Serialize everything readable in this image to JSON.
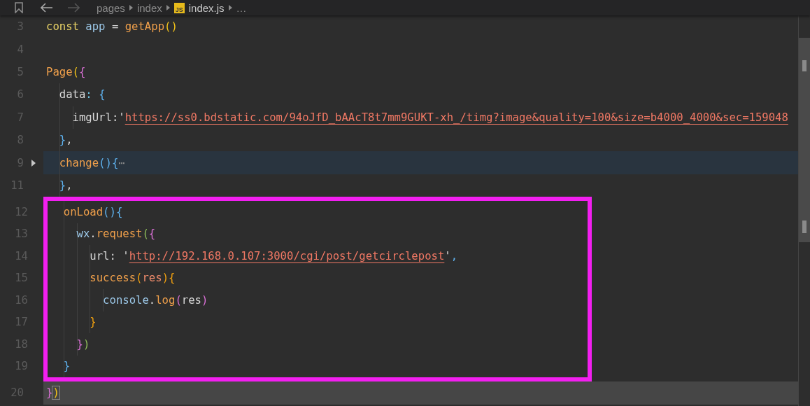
{
  "toolbar": {
    "forward_disabled": true,
    "breadcrumb": [
      {
        "label": "pages",
        "kind": "folder"
      },
      {
        "label": "index",
        "kind": "folder"
      },
      {
        "label": "index.js",
        "kind": "file",
        "badge": "JS"
      },
      {
        "label": "…",
        "kind": "more"
      }
    ]
  },
  "lines_above": [
    {
      "number": "3",
      "tokens": [
        {
          "text": "const ",
          "kind": "keyword"
        },
        {
          "text": "app",
          "kind": "variable"
        },
        {
          "text": " = ",
          "kind": "plain"
        },
        {
          "text": "getApp",
          "kind": "function"
        },
        {
          "text": "()",
          "kind": "bracket1"
        }
      ]
    },
    {
      "number": "4"
    },
    {
      "number": "5",
      "tokens": [
        {
          "text": "Page",
          "kind": "function"
        },
        {
          "text": "(",
          "kind": "bracket1"
        },
        {
          "text": "{",
          "kind": "bracket2"
        }
      ]
    },
    {
      "number": "6",
      "tokens": [
        {
          "text": "  data",
          "kind": "plain"
        },
        {
          "text": ": ",
          "kind": "punct"
        },
        {
          "text": "{",
          "kind": "bracket3"
        }
      ]
    },
    {
      "number": "7",
      "tokens": [
        {
          "text": "    imgUrl",
          "kind": "plain"
        },
        {
          "text": ":'",
          "kind": "plain"
        },
        {
          "text": "https://ss0.bdstatic.com/94oJfD_bAAcT8t7mm9GUKT-xh_/timg?image&quality=100&size=b4000_4000&sec=159048",
          "kind": "link"
        }
      ]
    },
    {
      "number": "8",
      "tokens": [
        {
          "text": "  }",
          "kind": "bracket3"
        },
        {
          "text": ",",
          "kind": "plain"
        }
      ]
    },
    {
      "number": "9",
      "folded": true,
      "tokens": [
        {
          "text": "  change",
          "kind": "function"
        },
        {
          "text": "(){",
          "kind": "bracket3"
        },
        {
          "text": "⋯",
          "kind": "fold"
        }
      ]
    },
    {
      "number": "11",
      "tokens": [
        {
          "text": "  }",
          "kind": "bracket3"
        },
        {
          "text": ",",
          "kind": "plain"
        }
      ]
    }
  ],
  "framed_lines": [
    {
      "number": "12",
      "tokens": [
        {
          "text": "  onLoad",
          "kind": "function"
        },
        {
          "text": "(){",
          "kind": "bracket3"
        }
      ]
    },
    {
      "number": "13",
      "tokens": [
        {
          "text": "    wx",
          "kind": "variable"
        },
        {
          "text": ".",
          "kind": "plain"
        },
        {
          "text": "request",
          "kind": "function"
        },
        {
          "text": "(",
          "kind": "bracket4"
        },
        {
          "text": "{",
          "kind": "bracket2"
        }
      ]
    },
    {
      "number": "14",
      "tokens": [
        {
          "text": "      url",
          "kind": "plain"
        },
        {
          "text": ": '",
          "kind": "plain"
        },
        {
          "text": "http://192.168.0.107:3000/cgi/post/getcirclepost",
          "kind": "link"
        },
        {
          "text": "'",
          "kind": "plain"
        },
        {
          "text": ",",
          "kind": "bracket3"
        }
      ]
    },
    {
      "number": "15",
      "tokens": [
        {
          "text": "      success",
          "kind": "function"
        },
        {
          "text": "(",
          "kind": "bracket5"
        },
        {
          "text": "res",
          "kind": "param"
        },
        {
          "text": "){",
          "kind": "bracket5"
        }
      ]
    },
    {
      "number": "16",
      "tokens": [
        {
          "text": "        console",
          "kind": "variable"
        },
        {
          "text": ".",
          "kind": "plain"
        },
        {
          "text": "log",
          "kind": "function"
        },
        {
          "text": "(",
          "kind": "bracket2"
        },
        {
          "text": "res",
          "kind": "plain"
        },
        {
          "text": ")",
          "kind": "bracket2"
        }
      ]
    },
    {
      "number": "17",
      "tokens": [
        {
          "text": "      }",
          "kind": "bracket5"
        }
      ]
    },
    {
      "number": "18",
      "tokens": [
        {
          "text": "    }",
          "kind": "bracket2"
        },
        {
          "text": ")",
          "kind": "bracket4"
        }
      ]
    },
    {
      "number": "19",
      "tokens": [
        {
          "text": "  }",
          "kind": "bracket3"
        }
      ]
    }
  ],
  "lines_below": [
    {
      "number": "20",
      "current": true,
      "tokens": [
        {
          "text": "}",
          "kind": "bracket2"
        },
        {
          "text": ")",
          "kind": "match"
        }
      ]
    }
  ]
}
